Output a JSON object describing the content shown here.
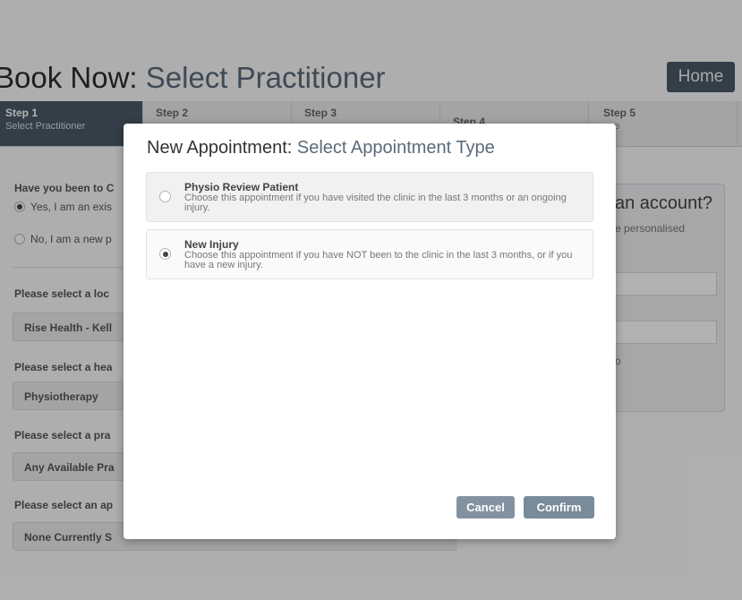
{
  "page": {
    "title_prefix": "Book Now: ",
    "title_accent": "Select Practitioner",
    "home_label": "Home"
  },
  "steps": [
    {
      "num": "Step 1",
      "desc": "Select Practitioner"
    },
    {
      "num": "Step 2",
      "desc": ""
    },
    {
      "num": "Step 3",
      "desc": ""
    },
    {
      "num": "Step 4",
      "desc": ""
    },
    {
      "num": "Step 5",
      "desc": "one"
    }
  ],
  "form": {
    "q_visited": "Have you been to C",
    "opt_existing": "Yes, I am an exis",
    "opt_new": "No, I am a new p",
    "q_location": "Please select a loc",
    "location_value": "Rise Health - Kell",
    "q_health": "Please select a hea",
    "health_value": "Physiotherapy",
    "q_practitioner": "Please select a pra",
    "practitioner_value": "Any Available Pra",
    "q_appointment": "Please select an ap",
    "appointment_value": "None Currently S"
  },
  "account_panel": {
    "title": "an account?",
    "subtitle": "e personalised",
    "link": "o"
  },
  "modal": {
    "title_prefix": "New Appointment: ",
    "title_accent": "Select Appointment Type",
    "options": [
      {
        "title": "Physio Review Patient",
        "desc": "Choose this appointment if you have visited the clinic in the last 3 months or an ongoing injury.",
        "selected": false
      },
      {
        "title": "New Injury",
        "desc": "Choose this appointment if you have NOT been to the clinic in the last 3 months, or if you have a new injury.",
        "selected": true
      }
    ],
    "cancel_label": "Cancel",
    "confirm_label": "Confirm"
  }
}
